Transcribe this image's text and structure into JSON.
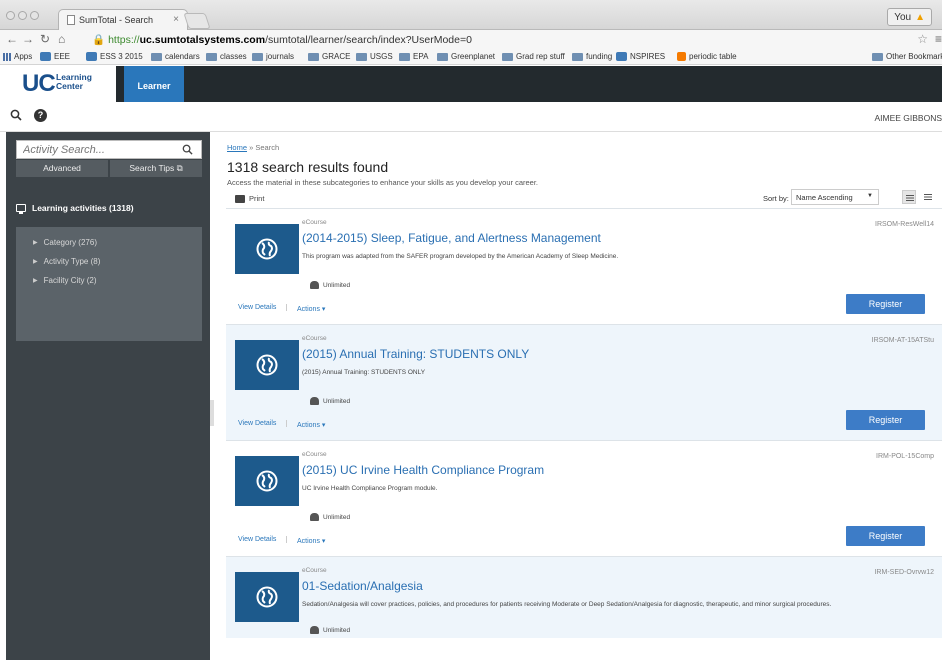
{
  "browser": {
    "tab_title": "SumTotal - Search",
    "tab_close": "×",
    "user_button": "You",
    "url_scheme": "https://",
    "url_host": "uc.sumtotalsystems.com",
    "url_path": "/sumtotal/learner/search/index?UserMode=0",
    "bookmarks": [
      {
        "label": "Apps",
        "icon": "apps-grid-icon"
      },
      {
        "label": "EEE",
        "icon": "clover-icon"
      },
      {
        "label": "ESS 3 2015",
        "icon": "clover-icon"
      },
      {
        "label": "calendars",
        "icon": "folder-icon"
      },
      {
        "label": "classes",
        "icon": "folder-icon"
      },
      {
        "label": "journals",
        "icon": "folder-icon"
      },
      {
        "label": "GRACE",
        "icon": "folder-icon"
      },
      {
        "label": "USGS",
        "icon": "folder-icon"
      },
      {
        "label": "EPA",
        "icon": "folder-icon"
      },
      {
        "label": "Greenplanet",
        "icon": "folder-icon"
      },
      {
        "label": "Grad rep stuff",
        "icon": "folder-icon"
      },
      {
        "label": "funding",
        "icon": "folder-icon"
      },
      {
        "label": "NSPIRES",
        "icon": "nspires-icon"
      },
      {
        "label": "periodic table",
        "icon": "orange-icon"
      }
    ],
    "other_bookmarks": "Other Bookmarks"
  },
  "header": {
    "logo_uc": "UC",
    "logo_line1": "Learning",
    "logo_line2": "Center",
    "active_tab": "Learner",
    "username": "AIMEE GIBBONS",
    "help_glyph": "?"
  },
  "sidebar": {
    "search_placeholder": "Activity Search...",
    "advanced_label": "Advanced",
    "search_tips_label": "Search Tips",
    "heading": "Learning activities (1318)",
    "facets": [
      {
        "label": "Category (276)"
      },
      {
        "label": "Activity Type (8)"
      },
      {
        "label": "Facility City (2)"
      }
    ]
  },
  "main": {
    "breadcrumb_home": "Home",
    "breadcrumb_sep": "»",
    "breadcrumb_current": "Search",
    "title": "1318 search results found",
    "subtitle": "Access the material in these subcategories to enhance your skills as you develop your career.",
    "print_label": "Print",
    "sort_label": "Sort by:",
    "sort_value": "Name Ascending",
    "results": [
      {
        "type": "eCourse",
        "title": "(2014-2015) Sleep, Fatigue, and Alertness Management",
        "description": "This program was adapted from the SAFER program developed by the American Academy of Sleep Medicine.",
        "code": "IRSOM-ResWell14",
        "availability": "Unlimited",
        "view_details": "View Details",
        "actions": "Actions ▾",
        "register": "Register"
      },
      {
        "type": "eCourse",
        "title": "(2015) Annual Training: STUDENTS ONLY",
        "description": "(2015) Annual Training: STUDENTS ONLY",
        "code": "IRSOM-AT-15ATStu",
        "availability": "Unlimited",
        "view_details": "View Details",
        "actions": "Actions ▾",
        "register": "Register"
      },
      {
        "type": "eCourse",
        "title": "(2015) UC Irvine Health Compliance Program",
        "description": "UC Irvine Health Compliance Program module.",
        "code": "IRM-POL-15Comp",
        "availability": "Unlimited",
        "view_details": "View Details",
        "actions": "Actions ▾",
        "register": "Register"
      },
      {
        "type": "eCourse",
        "title": "01-Sedation/Analgesia",
        "description": "Sedation/Analgesia will cover practices, policies, and procedures for patients receiving Moderate or Deep Sedation/Analgesia for diagnostic, therapeutic, and minor surgical procedures.",
        "code": "IRM-SED-Ovrvw12",
        "availability": "Unlimited"
      }
    ]
  },
  "colors": {
    "accent": "#2a77bb",
    "sidebar": "#3c4348",
    "header": "#232a2e",
    "register": "#3d7cc7"
  }
}
